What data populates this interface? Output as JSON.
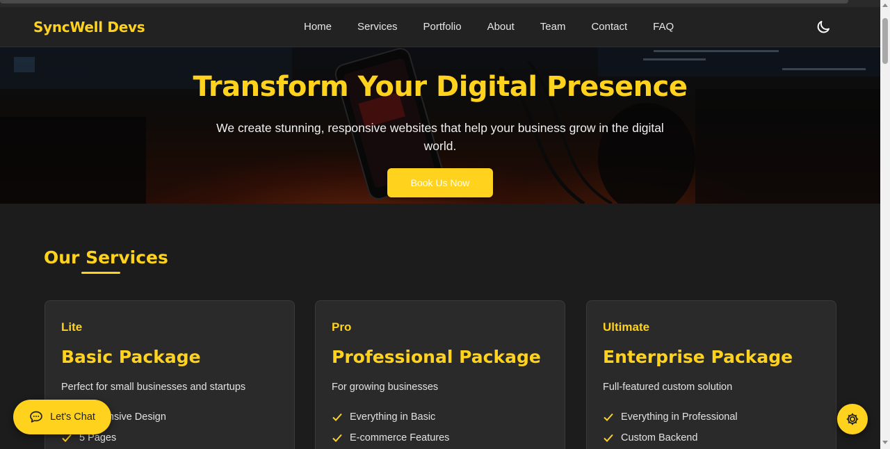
{
  "navbar": {
    "brand": "SyncWell Devs",
    "links": [
      "Home",
      "Services",
      "Portfolio",
      "About",
      "Team",
      "Contact",
      "FAQ"
    ],
    "theme_icon": "moon-icon"
  },
  "hero": {
    "title": "Transform Your Digital Presence",
    "subtitle": "We create stunning, responsive websites that help your business grow in the digital world.",
    "cta": "Book Us Now"
  },
  "services": {
    "title": "Our Services",
    "cards": [
      {
        "tier": "Lite",
        "name": "Basic Package",
        "description": "Perfect for small businesses and startups",
        "features": [
          "Responsive Design",
          "5 Pages"
        ]
      },
      {
        "tier": "Pro",
        "name": "Professional Package",
        "description": "For growing businesses",
        "features": [
          "Everything in Basic",
          "E-commerce Features"
        ]
      },
      {
        "tier": "Ultimate",
        "name": "Enterprise Package",
        "description": "Full-featured custom solution",
        "features": [
          "Everything in Professional",
          "Custom Backend"
        ]
      }
    ]
  },
  "chat": {
    "label": "Let's Chat",
    "icon": "chat-bubble-icon"
  },
  "settings": {
    "icon": "gear-icon"
  },
  "colors": {
    "accent": "#ffd21e",
    "background": "#1c1c1c",
    "card": "#2a2a2a",
    "navbar": "#222222"
  }
}
